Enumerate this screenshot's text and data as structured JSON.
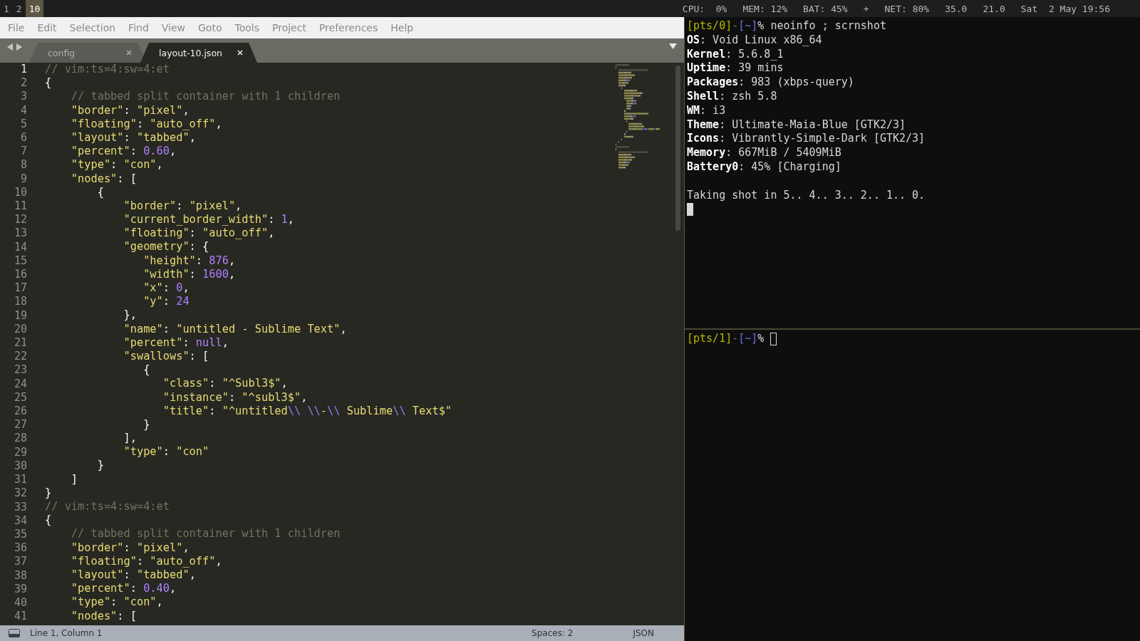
{
  "bar": {
    "workspaces": [
      {
        "label": "1",
        "selected": false
      },
      {
        "label": "2",
        "selected": false
      },
      {
        "label": "10",
        "selected": true
      }
    ],
    "stats": [
      "CPU:  0%",
      "MEM: 12%",
      "BAT: 45%",
      "+",
      "NET: 80%",
      "35.0",
      "21.0",
      "Sat  2 May 19:56"
    ]
  },
  "editor": {
    "menu": [
      "File",
      "Edit",
      "Selection",
      "Find",
      "View",
      "Goto",
      "Tools",
      "Project",
      "Preferences",
      "Help"
    ],
    "tabs": [
      {
        "label": "config",
        "selected": false
      },
      {
        "label": "layout-10.json",
        "selected": true
      }
    ],
    "lines": [
      {
        "n": "1",
        "selected": true,
        "tokens": [
          {
            "kind": "comment",
            "text": "// vim:ts=4:sw=4:et"
          }
        ]
      },
      {
        "n": "2",
        "selected": false,
        "tokens": [
          {
            "kind": "punct",
            "text": "{"
          }
        ]
      },
      {
        "n": "3",
        "selected": false,
        "tokens": [
          {
            "kind": "comment",
            "text": "    // tabbed split container with 1 children"
          }
        ]
      },
      {
        "n": "4",
        "selected": false,
        "tokens": [
          {
            "kind": "string",
            "text": "    \"border\""
          },
          {
            "kind": "punct",
            "text": ": "
          },
          {
            "kind": "string",
            "text": "\"pixel\""
          },
          {
            "kind": "punct",
            "text": ","
          }
        ]
      },
      {
        "n": "5",
        "selected": false,
        "tokens": [
          {
            "kind": "string",
            "text": "    \"floating\""
          },
          {
            "kind": "punct",
            "text": ": "
          },
          {
            "kind": "string",
            "text": "\"auto_off\""
          },
          {
            "kind": "punct",
            "text": ","
          }
        ]
      },
      {
        "n": "6",
        "selected": false,
        "tokens": [
          {
            "kind": "string",
            "text": "    \"layout\""
          },
          {
            "kind": "punct",
            "text": ": "
          },
          {
            "kind": "string",
            "text": "\"tabbed\""
          },
          {
            "kind": "punct",
            "text": ","
          }
        ]
      },
      {
        "n": "7",
        "selected": false,
        "tokens": [
          {
            "kind": "string",
            "text": "    \"percent\""
          },
          {
            "kind": "punct",
            "text": ": "
          },
          {
            "kind": "number",
            "text": "0.60"
          },
          {
            "kind": "punct",
            "text": ","
          }
        ]
      },
      {
        "n": "8",
        "selected": false,
        "tokens": [
          {
            "kind": "string",
            "text": "    \"type\""
          },
          {
            "kind": "punct",
            "text": ": "
          },
          {
            "kind": "string",
            "text": "\"con\""
          },
          {
            "kind": "punct",
            "text": ","
          }
        ]
      },
      {
        "n": "9",
        "selected": false,
        "tokens": [
          {
            "kind": "string",
            "text": "    \"nodes\""
          },
          {
            "kind": "punct",
            "text": ": ["
          }
        ]
      },
      {
        "n": "10",
        "selected": false,
        "tokens": [
          {
            "kind": "punct",
            "text": "        {"
          }
        ]
      },
      {
        "n": "11",
        "selected": false,
        "tokens": [
          {
            "kind": "string",
            "text": "            \"border\""
          },
          {
            "kind": "punct",
            "text": ": "
          },
          {
            "kind": "string",
            "text": "\"pixel\""
          },
          {
            "kind": "punct",
            "text": ","
          }
        ]
      },
      {
        "n": "12",
        "selected": false,
        "tokens": [
          {
            "kind": "string",
            "text": "            \"current_border_width\""
          },
          {
            "kind": "punct",
            "text": ": "
          },
          {
            "kind": "number",
            "text": "1"
          },
          {
            "kind": "punct",
            "text": ","
          }
        ]
      },
      {
        "n": "13",
        "selected": false,
        "tokens": [
          {
            "kind": "string",
            "text": "            \"floating\""
          },
          {
            "kind": "punct",
            "text": ": "
          },
          {
            "kind": "string",
            "text": "\"auto_off\""
          },
          {
            "kind": "punct",
            "text": ","
          }
        ]
      },
      {
        "n": "14",
        "selected": false,
        "tokens": [
          {
            "kind": "string",
            "text": "            \"geometry\""
          },
          {
            "kind": "punct",
            "text": ": {"
          }
        ]
      },
      {
        "n": "15",
        "selected": false,
        "tokens": [
          {
            "kind": "string",
            "text": "               \"height\""
          },
          {
            "kind": "punct",
            "text": ": "
          },
          {
            "kind": "number",
            "text": "876"
          },
          {
            "kind": "punct",
            "text": ","
          }
        ]
      },
      {
        "n": "16",
        "selected": false,
        "tokens": [
          {
            "kind": "string",
            "text": "               \"width\""
          },
          {
            "kind": "punct",
            "text": ": "
          },
          {
            "kind": "number",
            "text": "1600"
          },
          {
            "kind": "punct",
            "text": ","
          }
        ]
      },
      {
        "n": "17",
        "selected": false,
        "tokens": [
          {
            "kind": "string",
            "text": "               \"x\""
          },
          {
            "kind": "punct",
            "text": ": "
          },
          {
            "kind": "number",
            "text": "0"
          },
          {
            "kind": "punct",
            "text": ","
          }
        ]
      },
      {
        "n": "18",
        "selected": false,
        "tokens": [
          {
            "kind": "string",
            "text": "               \"y\""
          },
          {
            "kind": "punct",
            "text": ": "
          },
          {
            "kind": "number",
            "text": "24"
          }
        ]
      },
      {
        "n": "19",
        "selected": false,
        "tokens": [
          {
            "kind": "punct",
            "text": "            },"
          }
        ]
      },
      {
        "n": "20",
        "selected": false,
        "tokens": [
          {
            "kind": "string",
            "text": "            \"name\""
          },
          {
            "kind": "punct",
            "text": ": "
          },
          {
            "kind": "string",
            "text": "\"untitled - Sublime Text\""
          },
          {
            "kind": "punct",
            "text": ","
          }
        ]
      },
      {
        "n": "21",
        "selected": false,
        "tokens": [
          {
            "kind": "string",
            "text": "            \"percent\""
          },
          {
            "kind": "punct",
            "text": ": "
          },
          {
            "kind": "number",
            "text": "null"
          },
          {
            "kind": "punct",
            "text": ","
          }
        ]
      },
      {
        "n": "22",
        "selected": false,
        "tokens": [
          {
            "kind": "string",
            "text": "            \"swallows\""
          },
          {
            "kind": "punct",
            "text": ": ["
          }
        ]
      },
      {
        "n": "23",
        "selected": false,
        "tokens": [
          {
            "kind": "punct",
            "text": "               {"
          }
        ]
      },
      {
        "n": "24",
        "selected": false,
        "tokens": [
          {
            "kind": "string",
            "text": "                  \"class\""
          },
          {
            "kind": "punct",
            "text": ": "
          },
          {
            "kind": "string",
            "text": "\"^Subl3$\""
          },
          {
            "kind": "punct",
            "text": ","
          }
        ]
      },
      {
        "n": "25",
        "selected": false,
        "tokens": [
          {
            "kind": "string",
            "text": "                  \"instance\""
          },
          {
            "kind": "punct",
            "text": ": "
          },
          {
            "kind": "string",
            "text": "\"^subl3$\""
          },
          {
            "kind": "punct",
            "text": ","
          }
        ]
      },
      {
        "n": "26",
        "selected": false,
        "tokens": [
          {
            "kind": "string",
            "text": "                  \"title\""
          },
          {
            "kind": "punct",
            "text": ": "
          },
          {
            "kind": "string",
            "text": "\"^untitled"
          },
          {
            "kind": "escape",
            "text": "\\\\ \\\\"
          },
          {
            "kind": "string",
            "text": "-"
          },
          {
            "kind": "escape",
            "text": "\\\\"
          },
          {
            "kind": "string",
            "text": " Sublime"
          },
          {
            "kind": "escape",
            "text": "\\\\"
          },
          {
            "kind": "string",
            "text": " Text$\""
          }
        ]
      },
      {
        "n": "27",
        "selected": false,
        "tokens": [
          {
            "kind": "punct",
            "text": "               }"
          }
        ]
      },
      {
        "n": "28",
        "selected": false,
        "tokens": [
          {
            "kind": "punct",
            "text": "            ],"
          }
        ]
      },
      {
        "n": "29",
        "selected": false,
        "tokens": [
          {
            "kind": "string",
            "text": "            \"type\""
          },
          {
            "kind": "punct",
            "text": ": "
          },
          {
            "kind": "string",
            "text": "\"con\""
          }
        ]
      },
      {
        "n": "30",
        "selected": false,
        "tokens": [
          {
            "kind": "punct",
            "text": "        }"
          }
        ]
      },
      {
        "n": "31",
        "selected": false,
        "tokens": [
          {
            "kind": "punct",
            "text": "    ]"
          }
        ]
      },
      {
        "n": "32",
        "selected": false,
        "tokens": [
          {
            "kind": "punct",
            "text": "}"
          }
        ]
      },
      {
        "n": "33",
        "selected": false,
        "tokens": [
          {
            "kind": "comment",
            "text": "// vim:ts=4:sw=4:et"
          }
        ]
      },
      {
        "n": "34",
        "selected": false,
        "tokens": [
          {
            "kind": "punct",
            "text": "{"
          }
        ]
      },
      {
        "n": "35",
        "selected": false,
        "tokens": [
          {
            "kind": "comment",
            "text": "    // tabbed split container with 1 children"
          }
        ]
      },
      {
        "n": "36",
        "selected": false,
        "tokens": [
          {
            "kind": "string",
            "text": "    \"border\""
          },
          {
            "kind": "punct",
            "text": ": "
          },
          {
            "kind": "string",
            "text": "\"pixel\""
          },
          {
            "kind": "punct",
            "text": ","
          }
        ]
      },
      {
        "n": "37",
        "selected": false,
        "tokens": [
          {
            "kind": "string",
            "text": "    \"floating\""
          },
          {
            "kind": "punct",
            "text": ": "
          },
          {
            "kind": "string",
            "text": "\"auto_off\""
          },
          {
            "kind": "punct",
            "text": ","
          }
        ]
      },
      {
        "n": "38",
        "selected": false,
        "tokens": [
          {
            "kind": "string",
            "text": "    \"layout\""
          },
          {
            "kind": "punct",
            "text": ": "
          },
          {
            "kind": "string",
            "text": "\"tabbed\""
          },
          {
            "kind": "punct",
            "text": ","
          }
        ]
      },
      {
        "n": "39",
        "selected": false,
        "tokens": [
          {
            "kind": "string",
            "text": "    \"percent\""
          },
          {
            "kind": "punct",
            "text": ": "
          },
          {
            "kind": "number",
            "text": "0.40"
          },
          {
            "kind": "punct",
            "text": ","
          }
        ]
      },
      {
        "n": "40",
        "selected": false,
        "tokens": [
          {
            "kind": "string",
            "text": "    \"type\""
          },
          {
            "kind": "punct",
            "text": ": "
          },
          {
            "kind": "string",
            "text": "\"con\""
          },
          {
            "kind": "punct",
            "text": ","
          }
        ]
      },
      {
        "n": "41",
        "selected": false,
        "tokens": [
          {
            "kind": "string",
            "text": "    \"nodes\""
          },
          {
            "kind": "punct",
            "text": ": ["
          }
        ]
      }
    ],
    "status": {
      "position": "Line 1, Column 1",
      "indent": "Spaces: 2",
      "syntax": "JSON"
    }
  },
  "terminal": {
    "panes": [
      {
        "focused": true,
        "lines": [
          {
            "kind": "prompt",
            "cursor": false,
            "segments": [
              {
                "kind": "tty",
                "text": "[pts/0]"
              },
              {
                "kind": "dash",
                "text": "-"
              },
              {
                "kind": "dir",
                "text": "[~]"
              },
              {
                "kind": "plain",
                "text": "% neoinfo ; scrnshot"
              }
            ]
          },
          {
            "kind": "info",
            "label": "OS",
            "value": ": Void Linux x86_64"
          },
          {
            "kind": "info",
            "label": "Kernel",
            "value": ": 5.6.8_1"
          },
          {
            "kind": "info",
            "label": "Uptime",
            "value": ": 39 mins"
          },
          {
            "kind": "info",
            "label": "Packages",
            "value": ": 983 (xbps-query)"
          },
          {
            "kind": "info",
            "label": "Shell",
            "value": ": zsh 5.8"
          },
          {
            "kind": "info",
            "label": "WM",
            "value": ": i3"
          },
          {
            "kind": "info",
            "label": "Theme",
            "value": ": Ultimate-Maia-Blue [GTK2/3]"
          },
          {
            "kind": "info",
            "label": "Icons",
            "value": ": Vibrantly-Simple-Dark [GTK2/3]"
          },
          {
            "kind": "info",
            "label": "Memory",
            "value": ": 667MiB / 5409MiB"
          },
          {
            "kind": "info",
            "label": "Battery0",
            "value": ": 45% [Charging]"
          },
          {
            "kind": "blank"
          },
          {
            "kind": "text",
            "text": "Taking shot in 5.. 4.. 3.. 2.. 1.. 0."
          },
          {
            "kind": "cursor"
          }
        ]
      },
      {
        "focused": false,
        "lines": [
          {
            "kind": "prompt",
            "cursor": true,
            "segments": [
              {
                "kind": "tty",
                "text": "[pts/1]"
              },
              {
                "kind": "dash",
                "text": "-"
              },
              {
                "kind": "dir",
                "text": "[~]"
              },
              {
                "kind": "plain",
                "text": "%"
              }
            ]
          }
        ]
      }
    ]
  }
}
